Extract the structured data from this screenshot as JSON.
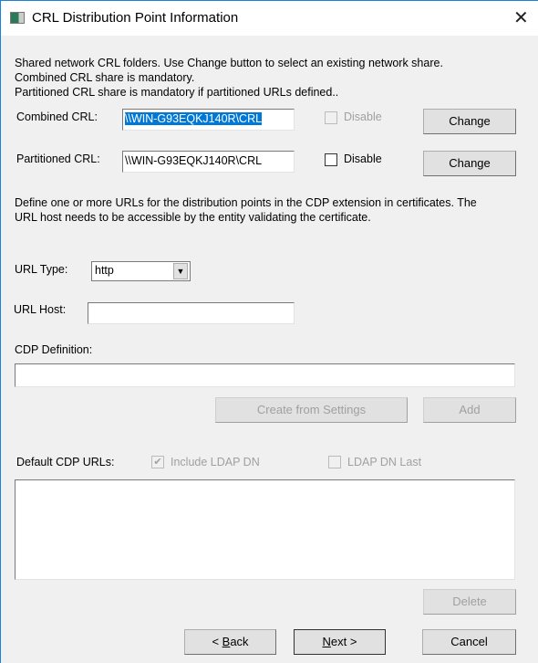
{
  "window": {
    "title": "CRL Distribution Point Information"
  },
  "intro": [
    "Shared network CRL folders. Use Change button to select an existing network share.",
    "Combined CRL share is mandatory.",
    "Partitioned CRL share is mandatory if partitioned URLs defined.."
  ],
  "combined": {
    "label": "Combined CRL:",
    "value": "\\\\WIN-G93EQKJ140R\\CRL",
    "disable_label": "Disable",
    "disable_checked": false,
    "disable_enabled": false,
    "change_label": "Change"
  },
  "partitioned": {
    "label": "Partitioned CRL:",
    "value": "\\\\WIN-G93EQKJ140R\\CRL",
    "disable_label": "Disable",
    "disable_checked": false,
    "change_label": "Change"
  },
  "url_desc": [
    "Define one or more URLs for the distribution points in the CDP extension in certificates. The",
    "URL host needs to be accessible by the entity validating the certificate."
  ],
  "url_type": {
    "label": "URL Type:",
    "value": "http"
  },
  "url_host": {
    "label": "URL Host:",
    "value": ""
  },
  "cdp": {
    "label": "CDP Definition:",
    "value": "",
    "create_label": "Create from Settings",
    "add_label": "Add"
  },
  "defaults": {
    "label": "Default CDP URLs:",
    "include_ldap_label": "Include LDAP DN",
    "include_ldap_checked": true,
    "ldap_last_label": "LDAP DN Last",
    "ldap_last_checked": false,
    "items": [],
    "delete_label": "Delete"
  },
  "footer": {
    "back_prefix": "< ",
    "back_key": "B",
    "back_rest": "ack",
    "next_key": "N",
    "next_rest": "ext >",
    "cancel_label": "Cancel"
  }
}
